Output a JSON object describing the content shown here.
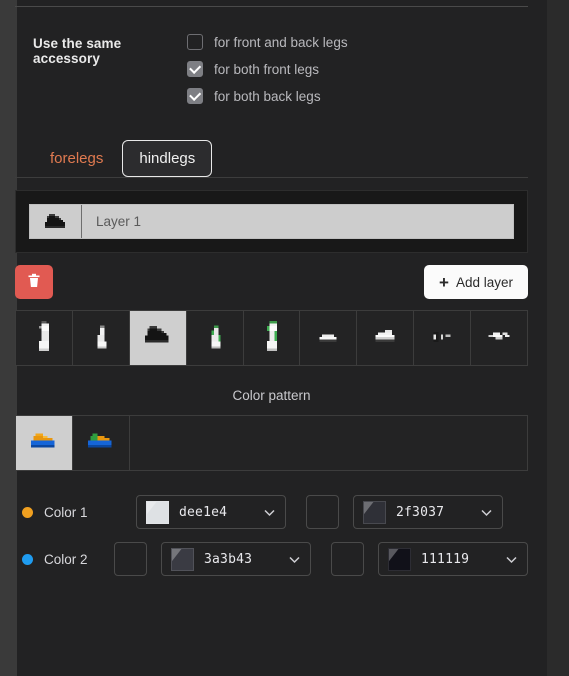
{
  "accessory": {
    "label": "Use the same accessory",
    "options": [
      {
        "label": "for front and back legs",
        "checked": false
      },
      {
        "label": "for both front legs",
        "checked": true
      },
      {
        "label": "for both back legs",
        "checked": true
      }
    ]
  },
  "tabs": [
    {
      "label": "forelegs",
      "active": false
    },
    {
      "label": "hindlegs",
      "active": true
    }
  ],
  "layers": {
    "items": [
      {
        "name": "Layer 1",
        "thumb_icon": "boot-sprite-icon"
      }
    ]
  },
  "actions": {
    "delete_icon": "trash-icon",
    "add_layer_label": "Add layer",
    "add_layer_plus": "+"
  },
  "sprite_toolbar": {
    "items": [
      {
        "icon": "sock-tall-white-icon",
        "selected": false
      },
      {
        "icon": "sock-short-white-icon",
        "selected": false
      },
      {
        "icon": "boot-white-icon",
        "selected": true
      },
      {
        "icon": "sock-short-green-icon",
        "selected": false
      },
      {
        "icon": "sock-tall-green-icon",
        "selected": false
      },
      {
        "icon": "shoe-small-icon",
        "selected": false
      },
      {
        "icon": "shoe-medium-icon",
        "selected": false
      },
      {
        "icon": "hoof-ring-icon",
        "selected": false
      },
      {
        "icon": "horseshoe-icon",
        "selected": false
      }
    ]
  },
  "color_pattern": {
    "title": "Color pattern",
    "items": [
      {
        "icon": "pattern-orange-blue-icon",
        "selected": true
      },
      {
        "icon": "pattern-green-orange-blue-icon",
        "selected": false
      }
    ]
  },
  "colors": {
    "rows": [
      {
        "name": "Color 1",
        "dot_color": "#f0a020",
        "left_dropdown": {
          "value": "dee1e4",
          "swatch": "#dee1e4"
        },
        "left_empty_box": false,
        "right_empty_box": true,
        "right_dropdown": {
          "value": "2f3037",
          "swatch": "#2f3037"
        }
      },
      {
        "name": "Color 2",
        "dot_color": "#1f9cf0",
        "left_dropdown": {
          "value": "3a3b43",
          "swatch": "#3a3b43"
        },
        "left_empty_box": true,
        "right_empty_box": true,
        "right_dropdown": {
          "value": "111119",
          "swatch": "#111119"
        }
      }
    ]
  },
  "theme": {
    "background": "#222223",
    "accent_orange": "#e07a50",
    "delete_red": "#e15a52",
    "selected_cell": "#cfcfcf"
  }
}
